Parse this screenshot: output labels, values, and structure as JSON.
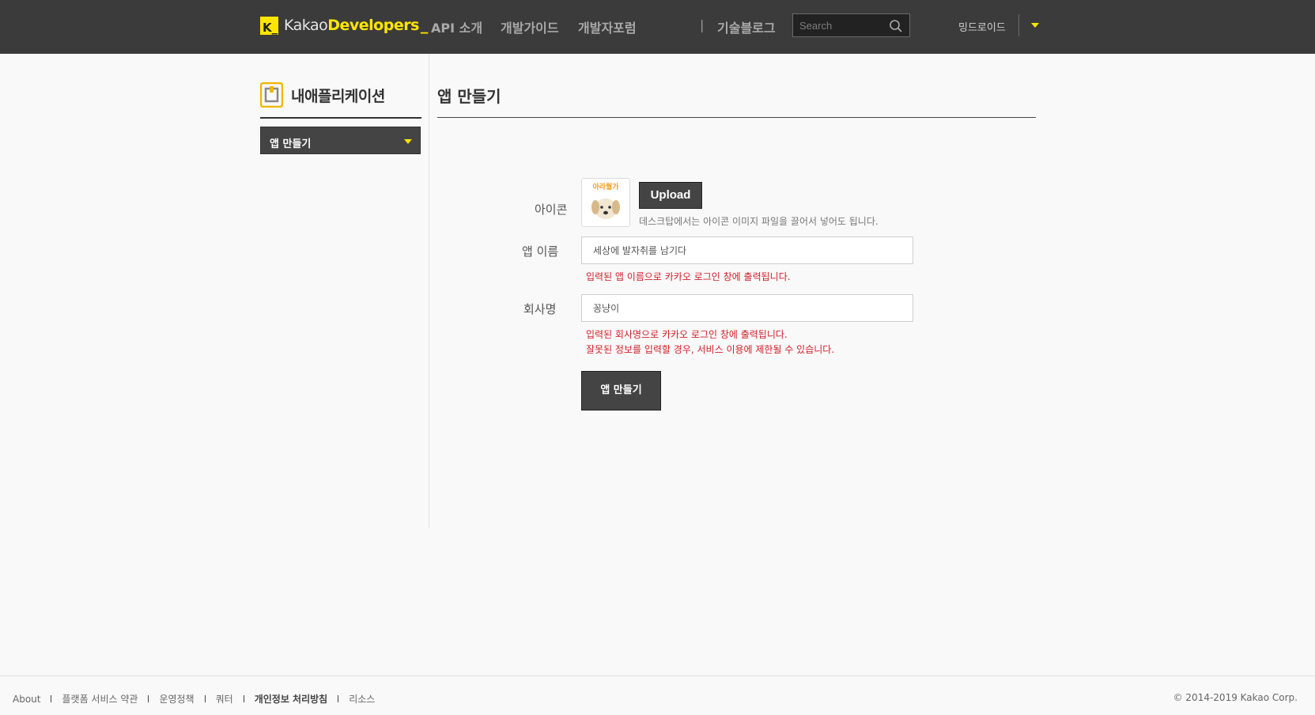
{
  "header": {
    "logo_kakao": "Kakao",
    "logo_dev": "Developers",
    "logo_under": "_",
    "logo_badge": "K_",
    "nav": [
      "API 소개",
      "개발가이드",
      "개발자포럼"
    ],
    "separator": "|",
    "blog": "기술블로그",
    "search_placeholder": "Search",
    "user": "밍드로이드",
    "accent_color": "#ffe600",
    "bg_color": "#3b3b3b"
  },
  "sidebar": {
    "title": "내애플리케이션",
    "select_value": "앱 만들기"
  },
  "main": {
    "title": "앱 만들기",
    "icon_label": "아이콘",
    "upload_label": "Upload",
    "upload_hint": "데스크탑에서는 아이콘 이미지 파일을 끌어서 넣어도 됩니다.",
    "app_name_label": "앱 이름",
    "app_name_value": "세상에 발자취를 남기다",
    "app_name_error": "입력된 앱 이름으로 카카오 로그인 창에 출력됩니다.",
    "company_label": "회사명",
    "company_value": "꽁냥이",
    "company_error_1": "입력된 회사명으로 카카오 로그인 창에 출력됩니다.",
    "company_error_2": "잘못된 정보를 입력할 경우, 서비스 이용에 제한될 수 있습니다.",
    "create_label": "앱 만들기",
    "icon_name": "puppy-app-icon",
    "error_color": "#d0202a"
  },
  "footer": {
    "links": [
      "About",
      "플랫폼 서비스 약관",
      "운영정책",
      "쿼터",
      "개인정보 처리방침",
      "리소스"
    ],
    "copyright": "© 2014-2019 Kakao Corp."
  }
}
